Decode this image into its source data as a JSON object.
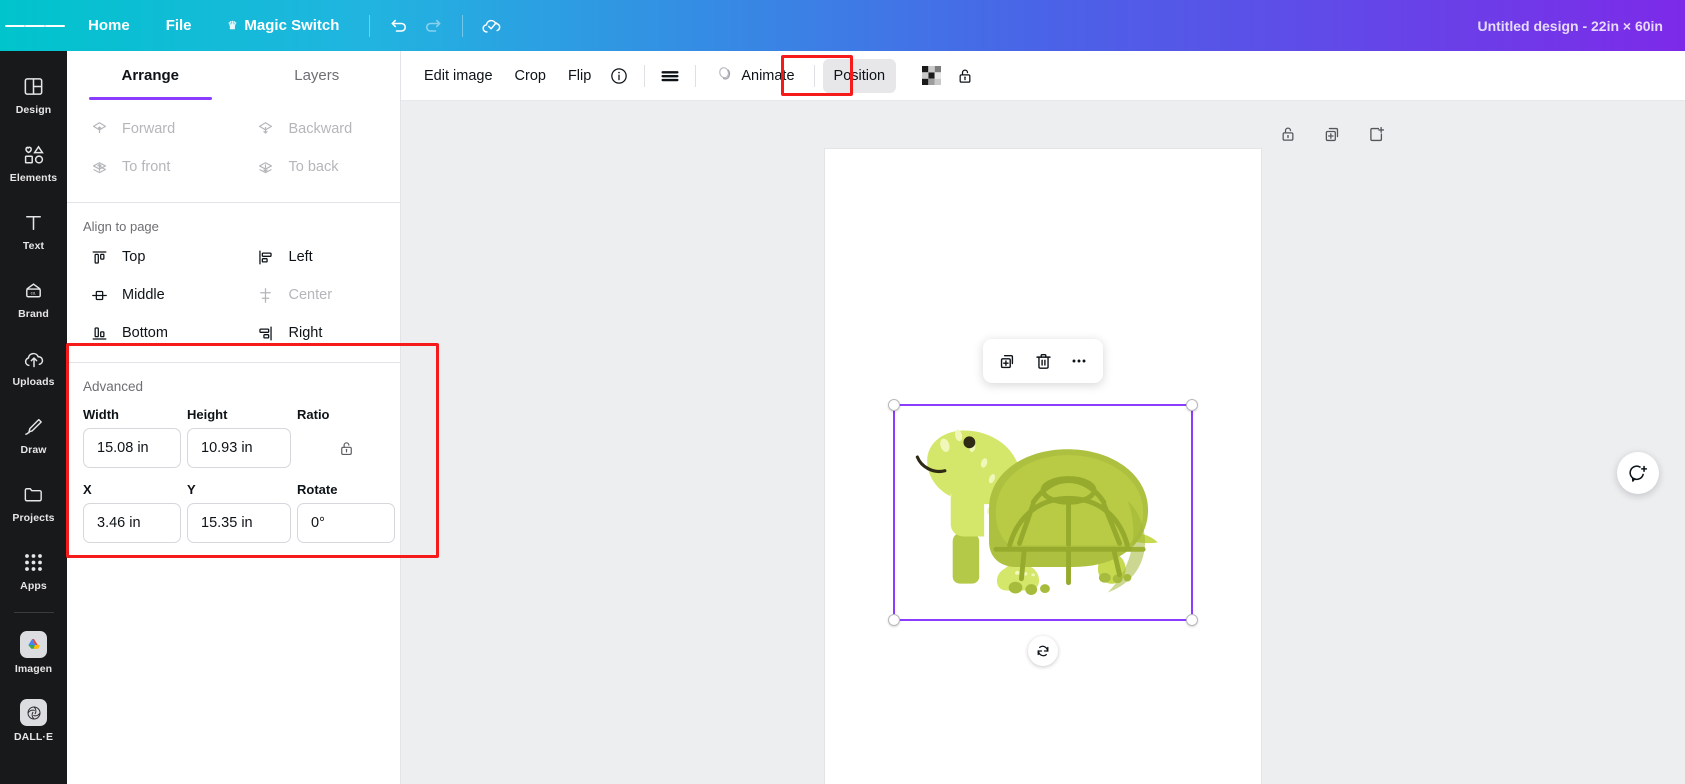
{
  "topbar": {
    "menu_icon": "hamburger-icon",
    "items": [
      {
        "label": "Home",
        "name": "home"
      },
      {
        "label": "File",
        "name": "file"
      },
      {
        "label": "Magic Switch",
        "name": "magic-switch",
        "crown": "♛"
      }
    ],
    "undo_icon": "undo-icon",
    "redo_icon": "redo-icon",
    "cloud_icon": "cloud-saved-icon",
    "design_title": "Untitled design - 22in × 60in"
  },
  "rail": {
    "items": [
      {
        "label": "Design",
        "icon": "layout-icon"
      },
      {
        "label": "Elements",
        "icon": "shapes-icon"
      },
      {
        "label": "Text",
        "icon": "text-icon"
      },
      {
        "label": "Brand",
        "icon": "brand-icon"
      },
      {
        "label": "Uploads",
        "icon": "upload-cloud-icon"
      },
      {
        "label": "Draw",
        "icon": "pen-icon"
      },
      {
        "label": "Projects",
        "icon": "folder-icon"
      },
      {
        "label": "Apps",
        "icon": "grid-dots-icon"
      }
    ],
    "apps": [
      {
        "label": "Imagen",
        "icon": "imagen-icon"
      },
      {
        "label": "DALL·E",
        "icon": "dalle-icon"
      }
    ]
  },
  "panel": {
    "tabs": [
      {
        "label": "Arrange",
        "active": true
      },
      {
        "label": "Layers",
        "active": false
      }
    ],
    "layer_actions": [
      {
        "label": "Forward",
        "icon": "layer-forward-icon",
        "disabled": true
      },
      {
        "label": "Backward",
        "icon": "layer-backward-icon",
        "disabled": true
      },
      {
        "label": "To front",
        "icon": "layer-to-front-icon",
        "disabled": true
      },
      {
        "label": "To back",
        "icon": "layer-to-back-icon",
        "disabled": true
      }
    ],
    "align_header": "Align to page",
    "align_actions": [
      {
        "label": "Top",
        "icon": "align-top-icon",
        "disabled": false
      },
      {
        "label": "Left",
        "icon": "align-left-icon",
        "disabled": false
      },
      {
        "label": "Middle",
        "icon": "align-middle-icon",
        "disabled": false
      },
      {
        "label": "Center",
        "icon": "align-center-icon",
        "disabled": true
      },
      {
        "label": "Bottom",
        "icon": "align-bottom-icon",
        "disabled": false
      },
      {
        "label": "Right",
        "icon": "align-right-icon",
        "disabled": false
      }
    ],
    "advanced": {
      "title": "Advanced",
      "width_label": "Width",
      "width_value": "15.08 in",
      "height_label": "Height",
      "height_value": "10.93 in",
      "ratio_label": "Ratio",
      "ratio_icon": "unlocked-padlock-icon",
      "x_label": "X",
      "x_value": "3.46 in",
      "y_label": "Y",
      "y_value": "15.35 in",
      "rotate_label": "Rotate",
      "rotate_value": "0°"
    }
  },
  "objbar": {
    "items": [
      {
        "label": "Edit image",
        "name": "edit-image"
      },
      {
        "label": "Crop",
        "name": "crop"
      },
      {
        "label": "Flip",
        "name": "flip"
      }
    ],
    "info_icon": "info-icon",
    "transparency_lines_icon": "lines-icon",
    "animate_label": "Animate",
    "animate_icon": "animate-icon",
    "position_label": "Position",
    "checker_icon": "transparency-checker-icon",
    "lock_icon": "unlocked-padlock-icon"
  },
  "canvas": {
    "page_tools": [
      {
        "icon": "unlocked-padlock-icon",
        "name": "lock-page"
      },
      {
        "icon": "duplicate-page-icon",
        "name": "duplicate-page"
      },
      {
        "icon": "add-page-icon",
        "name": "add-page"
      }
    ],
    "float_toolbar": [
      {
        "icon": "duplicate-icon",
        "name": "duplicate-element"
      },
      {
        "icon": "trash-icon",
        "name": "delete-element"
      },
      {
        "icon": "more-dots-icon",
        "name": "more-options"
      }
    ],
    "rotate_handle_icon": "rotate-icon",
    "comment_fab_icon": "add-comment-icon",
    "selected_element": "turtle-illustration"
  },
  "colors": {
    "accent_purple": "#8b3dff",
    "highlight_red": "#f61b1b",
    "rail_bg": "#18191b",
    "canvas_bg": "#edeef0"
  }
}
